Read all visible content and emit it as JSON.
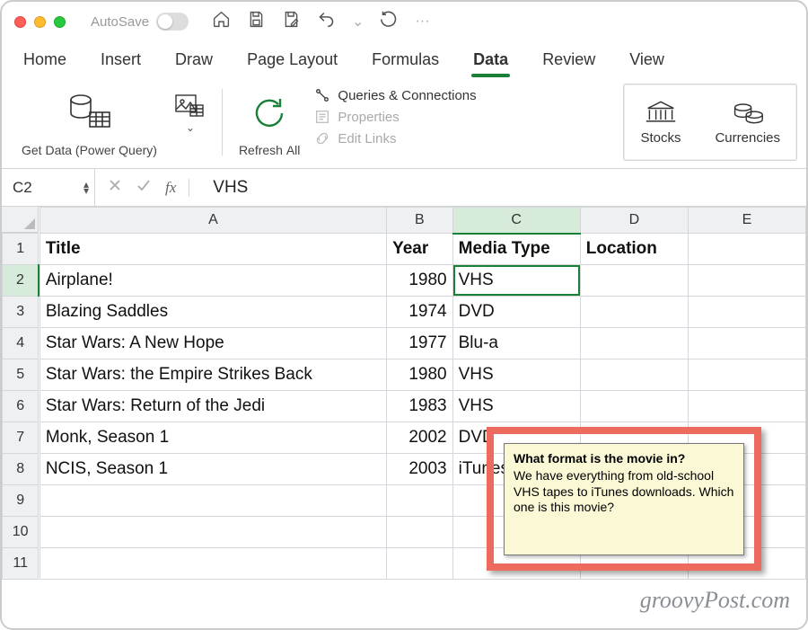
{
  "titlebar": {
    "autosave_label": "AutoSave"
  },
  "tabs": [
    {
      "label": "Home"
    },
    {
      "label": "Insert"
    },
    {
      "label": "Draw"
    },
    {
      "label": "Page Layout"
    },
    {
      "label": "Formulas"
    },
    {
      "label": "Data",
      "active": true
    },
    {
      "label": "Review"
    },
    {
      "label": "View"
    }
  ],
  "ribbon": {
    "get_data_label": "Get Data (Power Query)",
    "refresh_label": "Refresh All",
    "queries_label": "Queries & Connections",
    "properties_label": "Properties",
    "editlinks_label": "Edit Links",
    "stocks_label": "Stocks",
    "currencies_label": "Currencies"
  },
  "formula_bar": {
    "namebox": "C2",
    "formula": "VHS"
  },
  "columns": [
    "A",
    "B",
    "C",
    "D",
    "E"
  ],
  "selected_column": "C",
  "selected_row": 2,
  "spreadsheet": {
    "headers": [
      "Title",
      "Year",
      "Media Type",
      "Location"
    ],
    "rows": [
      {
        "title": "Airplane!",
        "year": 1980,
        "media": "VHS",
        "location": ""
      },
      {
        "title": "Blazing Saddles",
        "year": 1974,
        "media": "DVD",
        "location": ""
      },
      {
        "title": "Star Wars: A New Hope",
        "year": 1977,
        "media": "Blu-a",
        "location": ""
      },
      {
        "title": "Star Wars: the Empire Strikes Back",
        "year": 1980,
        "media": "VHS",
        "location": ""
      },
      {
        "title": "Star Wars: Return of the Jedi",
        "year": 1983,
        "media": "VHS",
        "location": ""
      },
      {
        "title": "Monk, Season 1",
        "year": 2002,
        "media": "DVD",
        "location": ""
      },
      {
        "title": "NCIS, Season 1",
        "year": 2003,
        "media": "iTunes",
        "location": ""
      }
    ]
  },
  "comment": {
    "title": "What format is the movie in?",
    "body": "We have everything from old-school VHS tapes to iTunes downloads. Which one is this movie?"
  },
  "watermark": "groovyPost.com"
}
